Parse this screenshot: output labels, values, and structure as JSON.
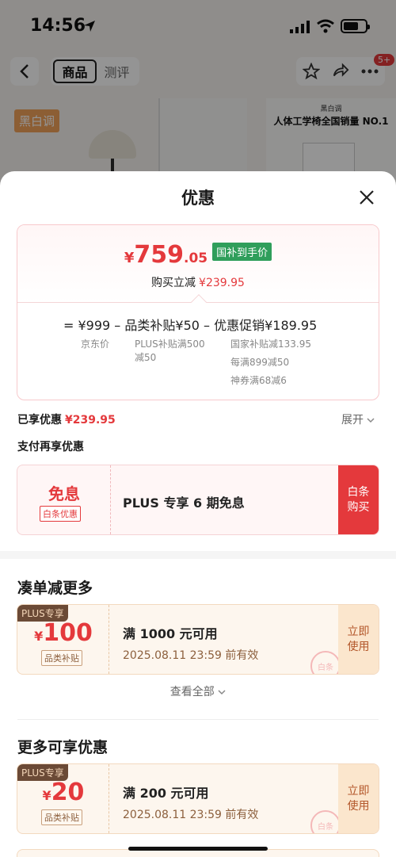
{
  "status": {
    "time": "14:56"
  },
  "nav": {
    "tabs": [
      "商品",
      "测评"
    ],
    "badge": "5+"
  },
  "background": {
    "brand_tag": "黑白调",
    "hero_right_small": "黑白调",
    "hero_right_title": "人体工学椅全国销量 NO.1"
  },
  "sheet": {
    "title": "优惠",
    "price": {
      "currency": "¥",
      "integer": "759",
      "decimal": ".05",
      "tag": "国补到手价",
      "buy_label": "购买立减",
      "buy_amount": "¥239.95"
    },
    "formula": {
      "text": "=  ¥999  –  品类补贴¥50  –  优惠促销¥189.95",
      "jd_price": "京东价",
      "plus_note_1": "PLUS补贴满500",
      "plus_note_2": "减50",
      "promo_1": "国家补贴减133.95",
      "promo_2": "每满899减50",
      "promo_3": "神券满68减6"
    },
    "enjoyed_label": "已享优惠",
    "enjoyed_amount": "¥239.95",
    "expand_label": "展开",
    "pay_title": "支付再享优惠",
    "baitiao": {
      "title": "免息",
      "tag": "白条优惠",
      "text": "PLUS 专享 6 期免息",
      "button": "白条购买"
    },
    "section1": {
      "title": "凑单减更多",
      "coupon": {
        "plus_tag": "PLUS专享",
        "currency": "¥",
        "amount": "100",
        "category": "品类补贴",
        "condition": "满 1000 元可用",
        "expiry": "2025.08.11 23:59 前有效",
        "button": "立即使用",
        "stamp": "白条"
      },
      "see_all": "查看全部"
    },
    "section2": {
      "title": "更多可享优惠",
      "coupon": {
        "plus_tag": "PLUS专享",
        "currency": "¥",
        "amount": "20",
        "category": "品类补贴",
        "condition": "满 200 元可用",
        "expiry": "2025.08.11 23:59 前有效",
        "button": "立即使用",
        "stamp": "白条"
      }
    }
  },
  "colors": {
    "accent_red": "#e4393c",
    "gov_green": "#2f9e5b",
    "coupon_bg": "#fdf6ee",
    "plus_brown": "#6b4a36"
  }
}
